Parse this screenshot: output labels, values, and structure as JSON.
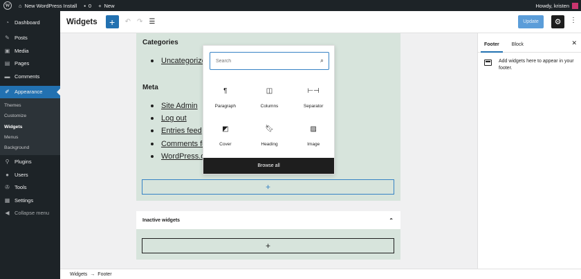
{
  "admin_bar": {
    "site_name": "New WordPress Install",
    "comments_count": "0",
    "new_label": "New",
    "greeting": "Howdy, kristen"
  },
  "sidebar": {
    "items": [
      {
        "label": "Dashboard",
        "icon": "dashboard-icon"
      },
      {
        "label": "Posts",
        "icon": "pin-icon"
      },
      {
        "label": "Media",
        "icon": "media-icon"
      },
      {
        "label": "Pages",
        "icon": "page-icon"
      },
      {
        "label": "Comments",
        "icon": "comment-icon"
      },
      {
        "label": "Appearance",
        "icon": "brush-icon",
        "active": true
      },
      {
        "label": "Plugins",
        "icon": "plug-icon"
      },
      {
        "label": "Users",
        "icon": "users-icon"
      },
      {
        "label": "Tools",
        "icon": "wrench-icon"
      },
      {
        "label": "Settings",
        "icon": "settings-icon"
      },
      {
        "label": "Collapse menu",
        "icon": "collapse-icon"
      }
    ],
    "submenu": [
      "Themes",
      "Customize",
      "Widgets",
      "Menus",
      "Background"
    ],
    "submenu_current": "Widgets"
  },
  "header": {
    "title": "Widgets",
    "update_label": "Update"
  },
  "widgets_area": {
    "categories_heading": "Categories",
    "categories_items": [
      "Uncategorized"
    ],
    "meta_heading": "Meta",
    "meta_items": [
      "Site Admin",
      "Log out",
      "Entries feed",
      "Comments feed",
      "WordPress.org"
    ],
    "appender_label": "+"
  },
  "inserter": {
    "search_placeholder": "Search",
    "blocks": [
      {
        "label": "Paragraph",
        "icon": "paragraph-icon"
      },
      {
        "label": "Columns",
        "icon": "columns-icon"
      },
      {
        "label": "Separator",
        "icon": "separator-icon"
      },
      {
        "label": "Cover",
        "icon": "cover-icon"
      },
      {
        "label": "Heading",
        "icon": "heading-icon"
      },
      {
        "label": "Image",
        "icon": "image-icon"
      }
    ],
    "browse_all": "Browse all"
  },
  "inactive": {
    "title": "Inactive widgets",
    "appender_label": "+"
  },
  "panel": {
    "tab_footer": "Footer",
    "tab_block": "Block",
    "hint": "Add widgets here to appear in your footer."
  },
  "breadcrumb": {
    "root": "Widgets",
    "arrow": "→",
    "current": "Footer"
  },
  "colors": {
    "accent": "#2271b1",
    "admin_dark": "#1d2327",
    "widget_area_bg": "#d7e4dc"
  }
}
